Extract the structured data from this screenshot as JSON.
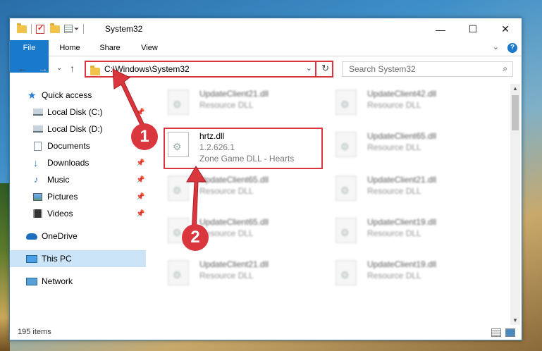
{
  "window": {
    "title": "System32",
    "controls": {
      "minimize": "—",
      "maximize": "☐",
      "close": "✕"
    }
  },
  "ribbon": {
    "tabs": [
      "File",
      "Home",
      "Share",
      "View"
    ],
    "help": "?",
    "expand": "⌄"
  },
  "nav": {
    "back": "←",
    "forward": "→",
    "recent": "⌄",
    "up": "↑",
    "address": "C:\\Windows\\System32",
    "address_dropdown": "⌄",
    "refresh": "↻",
    "search_placeholder": "Search System32",
    "search_icon": "⌕"
  },
  "sidebar": {
    "items": [
      {
        "label": "Quick access",
        "icon": "star-icon",
        "pinned": false
      },
      {
        "label": "Local Disk (C:)",
        "icon": "drive-icon",
        "pinned": true
      },
      {
        "label": "Local Disk (D:)",
        "icon": "drive-icon",
        "pinned": false
      },
      {
        "label": "Documents",
        "icon": "documents-icon",
        "pinned": true
      },
      {
        "label": "Downloads",
        "icon": "download-icon",
        "pinned": true
      },
      {
        "label": "Music",
        "icon": "music-icon",
        "pinned": true
      },
      {
        "label": "Pictures",
        "icon": "pictures-icon",
        "pinned": true
      },
      {
        "label": "Videos",
        "icon": "videos-icon",
        "pinned": true
      },
      {
        "label": "OneDrive",
        "icon": "cloud-icon",
        "pinned": false
      },
      {
        "label": "This PC",
        "icon": "computer-icon",
        "pinned": false,
        "selected": true
      },
      {
        "label": "Network",
        "icon": "network-icon",
        "pinned": false
      }
    ],
    "pin_glyph": "📌"
  },
  "files": {
    "left": [
      {
        "name": "UpdateClient21.dll",
        "sub": "Resource DLL"
      },
      {
        "name": "hrtz.dll",
        "sub": "1.2.626.1",
        "sub2": "Zone Game DLL - Hearts"
      },
      {
        "name": "UpdateClient65.dll",
        "sub": "Resource DLL"
      },
      {
        "name": "UpdateClient65.dll",
        "sub": "Resource DLL"
      },
      {
        "name": "UpdateClient21.dll",
        "sub": "Resource DLL"
      }
    ],
    "right": [
      {
        "name": "UpdateClient42.dll",
        "sub": "Resource DLL"
      },
      {
        "name": "UpdateClient65.dll",
        "sub": "Resource DLL"
      },
      {
        "name": "UpdateClient21.dll",
        "sub": "Resource DLL"
      },
      {
        "name": "UpdateClient19.dll",
        "sub": "Resource DLL"
      },
      {
        "name": "UpdateClient19.dll",
        "sub": "Resource DLL"
      }
    ]
  },
  "status": {
    "count": "195 items"
  },
  "annotations": {
    "step1": "1",
    "step2": "2"
  },
  "colors": {
    "accent": "#1979ca",
    "highlight": "#d9363e",
    "selection": "#cce4f7"
  }
}
